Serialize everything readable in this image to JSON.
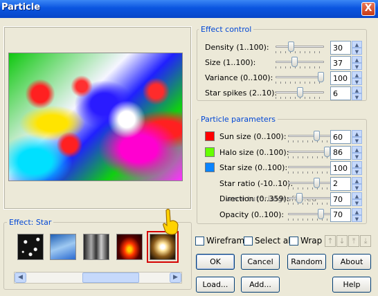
{
  "window": {
    "title": "Particle",
    "close_glyph": "X"
  },
  "watermark": "www.tutorialgrafici.eu",
  "effect_control": {
    "title": "Effect control",
    "rows": [
      {
        "label": "Density (1..100):",
        "value": "30",
        "position": 0.3
      },
      {
        "label": "Size (1..100):",
        "value": "37",
        "position": 0.37
      },
      {
        "label": "Variance (0..100):",
        "value": "100",
        "position": 1.0
      },
      {
        "label": "Star spikes (2..10):",
        "value": "6",
        "position": 0.5
      }
    ]
  },
  "particle_parameters": {
    "title": "Particle parameters",
    "rows": [
      {
        "label": "Sun size (0..100):",
        "value": "60",
        "position": 0.6,
        "swatch": "#ff0000"
      },
      {
        "label": "Halo size (0..100):",
        "value": "86",
        "position": 0.86,
        "swatch": "#66ff00"
      },
      {
        "label": "Star size (0..100):",
        "value": "100",
        "position": 1.0,
        "swatch": "#0a84ff"
      },
      {
        "label": "Star ratio (-10..10):",
        "value": "2",
        "position": 0.6
      },
      {
        "label": "Direction (0..359):",
        "value": "70",
        "position": 0.2
      },
      {
        "label": "Opacity (0..100):",
        "value": "70",
        "position": 0.7
      }
    ]
  },
  "effect": {
    "title": "Effect: Star"
  },
  "checkboxes": {
    "wireframe": "Wireframe",
    "select_all": "Select all",
    "wrap": "Wrap"
  },
  "buttons": {
    "ok": "OK",
    "cancel": "Cancel",
    "random": "Random",
    "about": "About",
    "load": "Load...",
    "add": "Add...",
    "help": "Help"
  },
  "arrow_buttons": [
    "↑",
    "↓",
    "⤒",
    "⤓"
  ]
}
